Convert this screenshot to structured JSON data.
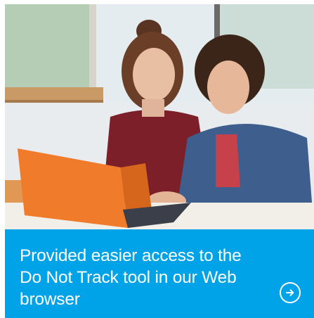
{
  "promo": {
    "caption": "Provided easier access to the Do Not Track tool in our Web browser",
    "link_icon": "arrow-right-circle-icon",
    "photo_alt": "two-people-using-laptop-photo",
    "colors": {
      "caption_bg": "#00a2e8",
      "caption_text": "#ffffff",
      "laptop": "#f07b2a"
    }
  }
}
